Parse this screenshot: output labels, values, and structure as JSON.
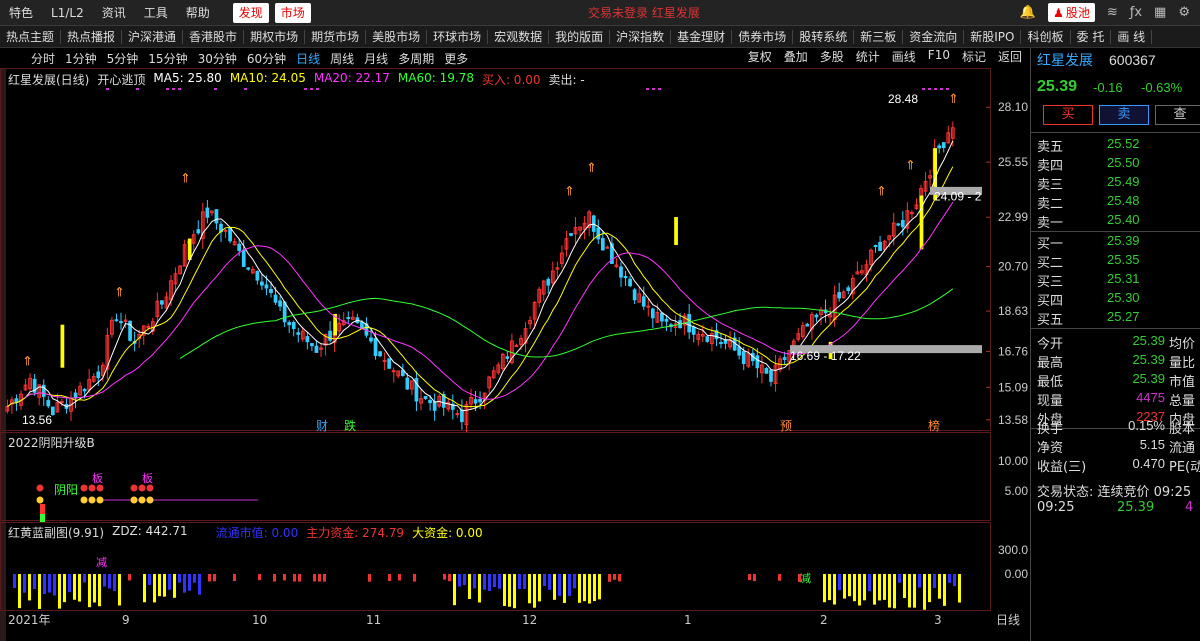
{
  "topbar": {
    "items": [
      "特色",
      "L1/L2",
      "资讯",
      "工具",
      "帮助"
    ],
    "active_tabs": [
      "发现",
      "市场"
    ],
    "title_text": "交易未登录  红星发展",
    "stock_pool": "股池"
  },
  "market_tabs": [
    "热点主题",
    "热点播报",
    "沪深港通",
    "香港股市",
    "期权市场",
    "期货市场",
    "美股市场",
    "环球市场",
    "宏观数据",
    "我的版面",
    "沪深指数",
    "基金理财",
    "债券市场",
    "股转系统",
    "新三板",
    "资金流向",
    "新股IPO",
    "科创板",
    "委 托",
    "画 线"
  ],
  "period_bar": {
    "items": [
      "分时",
      "1分钟",
      "5分钟",
      "15分钟",
      "30分钟",
      "60分钟",
      "日线",
      "周线",
      "月线",
      "多周期",
      "更多"
    ],
    "selected": "日线",
    "right_items": [
      "复权",
      "叠加",
      "多股",
      "统计",
      "画线",
      "F10",
      "标记",
      "返回"
    ]
  },
  "main_chart": {
    "title": "红星发展(日线)",
    "indicator": "开心逃顶",
    "ma5": "MA5: 25.80",
    "ma10": "MA10: 24.05",
    "ma20": "MA20: 22.17",
    "ma60": "MA60: 19.78",
    "buy_in": "买入: 0.00",
    "sell_out": "卖出: -",
    "price_ticks": [
      "28.10",
      "25.55",
      "22.99",
      "20.70",
      "18.63",
      "16.76",
      "15.09",
      "13.58"
    ],
    "annotations": {
      "high": "28.48",
      "low": "13.56",
      "zone_upper": "24.09 - 2",
      "zone_lower": "16.69 - 17.22"
    },
    "event_marks": [
      "财",
      "跌",
      "预",
      "榜"
    ]
  },
  "sub1": {
    "title": "2022阴阳升级B",
    "ticks": [
      "10.00",
      "5.00"
    ],
    "labels": [
      "阴阳",
      "板",
      "板"
    ]
  },
  "sub2": {
    "title": "红黄蓝副图(9.91)",
    "zdz": "ZDZ: 442.71",
    "flow1": "流通市值: 0.00",
    "flow2": "主力资金: 274.79",
    "flow3": "大资金: 0.00",
    "ticks": [
      "300.0",
      "0.00"
    ],
    "labels": [
      "减",
      "减"
    ]
  },
  "time_axis": [
    "2021年",
    "9",
    "10",
    "11",
    "12",
    "1",
    "2",
    "3"
  ],
  "period_label": "日线",
  "quote": {
    "name": "红星发展",
    "code": "600367",
    "price": "25.39",
    "change": "-0.16",
    "pct": "-0.63%",
    "buttons": [
      "买",
      "卖",
      "查"
    ],
    "asks": [
      {
        "label": "卖五",
        "price": "25.52"
      },
      {
        "label": "卖四",
        "price": "25.50"
      },
      {
        "label": "卖三",
        "price": "25.49"
      },
      {
        "label": "卖二",
        "price": "25.48"
      },
      {
        "label": "卖一",
        "price": "25.40"
      }
    ],
    "bids": [
      {
        "label": "买一",
        "price": "25.39"
      },
      {
        "label": "买二",
        "price": "25.35"
      },
      {
        "label": "买三",
        "price": "25.31"
      },
      {
        "label": "买四",
        "price": "25.30"
      },
      {
        "label": "买五",
        "price": "25.27"
      }
    ],
    "stats1": [
      {
        "l": "今开",
        "v": "25.39",
        "c": "#3c3",
        "r": "均价"
      },
      {
        "l": "最高",
        "v": "25.39",
        "c": "#3c3",
        "r": "量比"
      },
      {
        "l": "最低",
        "v": "25.39",
        "c": "#3c3",
        "r": "市值"
      },
      {
        "l": "现量",
        "v": "4475",
        "c": "#c3c",
        "r": "总量"
      },
      {
        "l": "外盘",
        "v": "2237",
        "c": "#e33",
        "r": "内盘"
      }
    ],
    "stats2": [
      {
        "l": "换手",
        "v": "0.15%",
        "c": "#ddd",
        "r": "股本"
      },
      {
        "l": "净资",
        "v": "5.15",
        "c": "#ddd",
        "r": "流通"
      },
      {
        "l": "收益(三)",
        "v": "0.470",
        "c": "#ddd",
        "r": "PE(动"
      }
    ],
    "trade_status": "交易状态: 连续竞价 09:25",
    "tick_time": "09:25",
    "tick_price": "25.39",
    "tick_vol": "4"
  },
  "colors": {
    "up": "#ff3333",
    "down": "#33ccff",
    "ma5": "#ffffff",
    "ma10": "#ffff00",
    "ma20": "#ff33ff",
    "ma60": "#33ff33"
  }
}
